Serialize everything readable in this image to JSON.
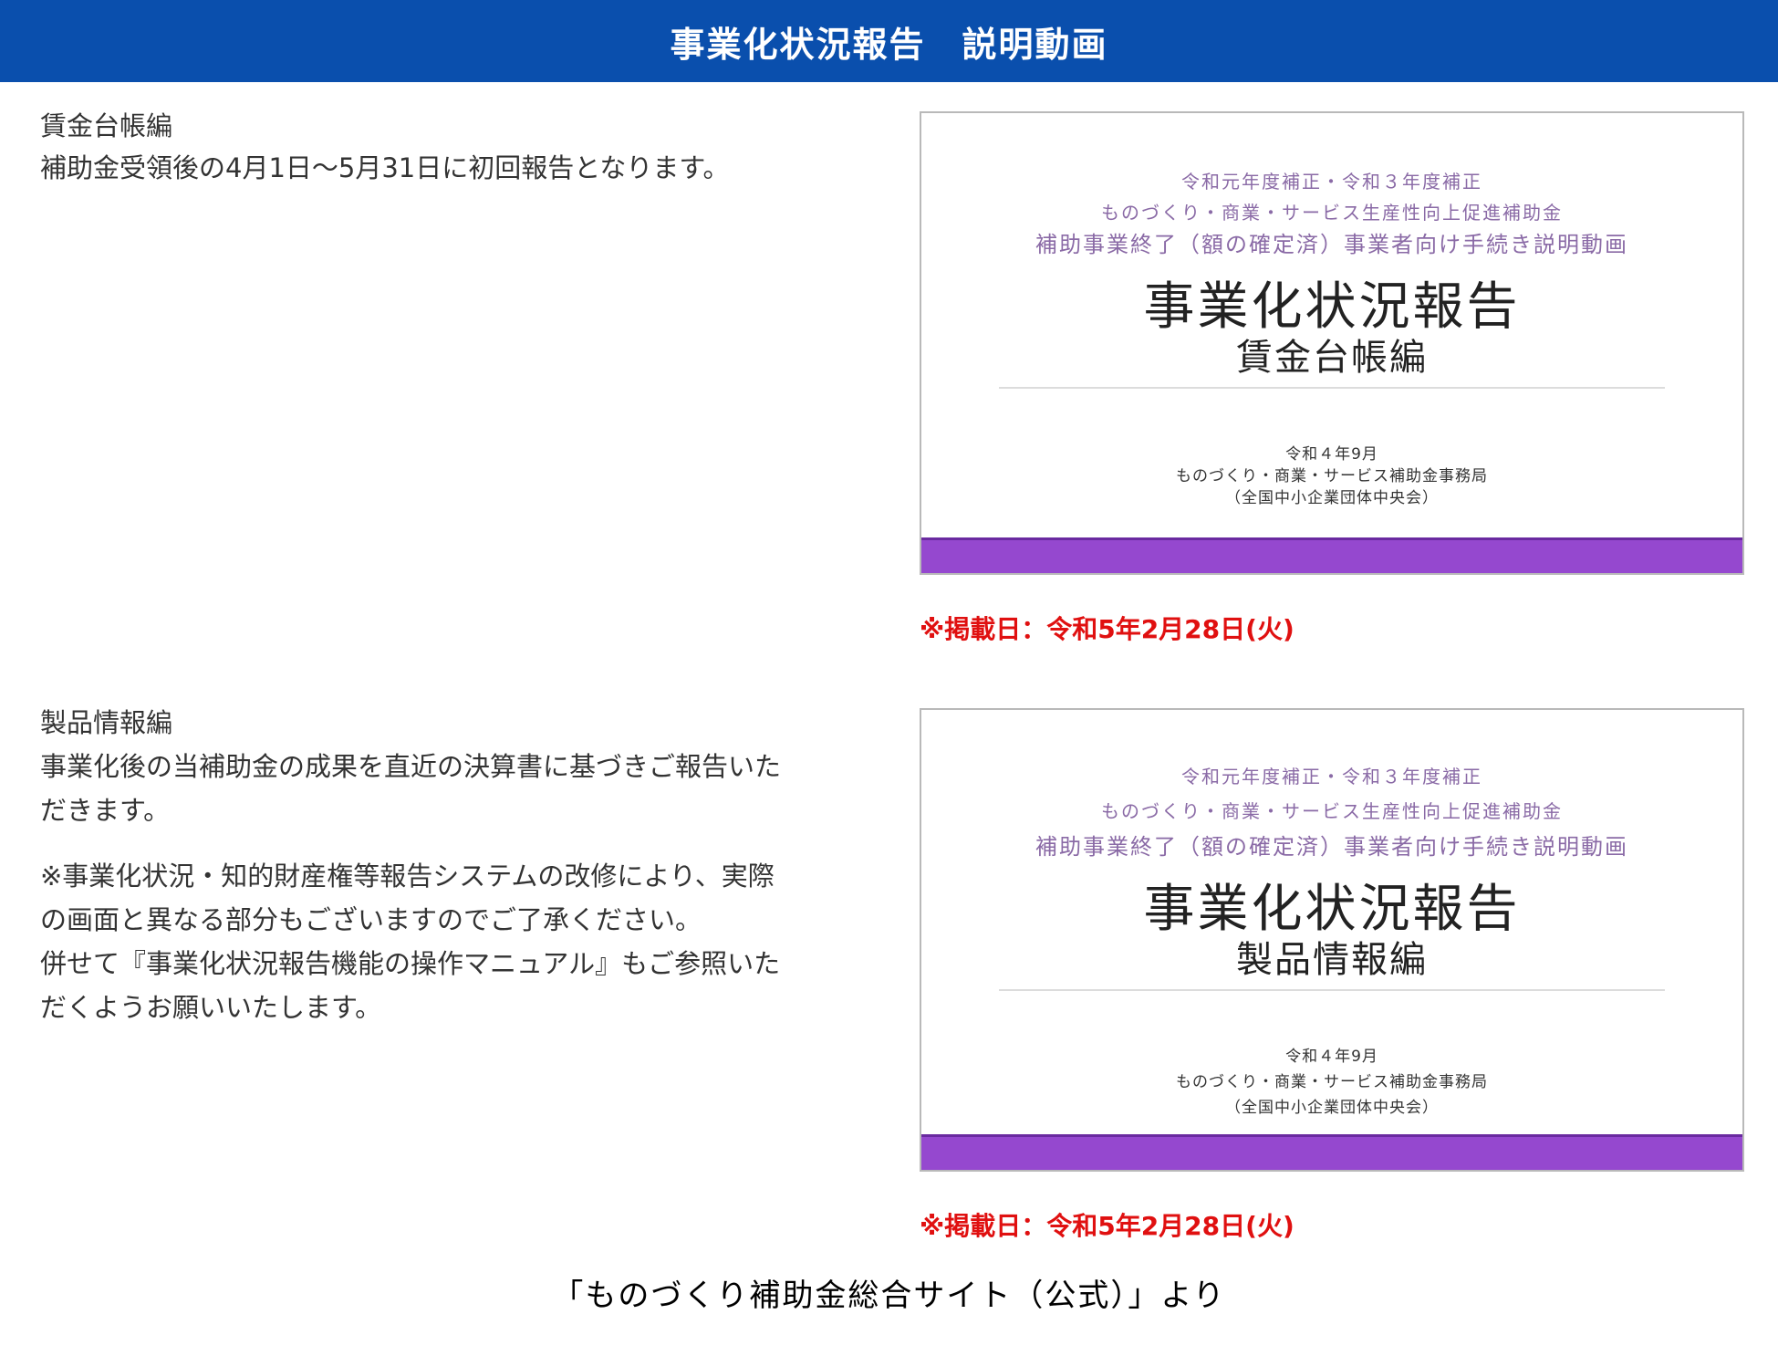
{
  "header": {
    "title": "事業化状況報告　説明動画"
  },
  "sections": [
    {
      "heading": "賃金台帳編",
      "description": "補助金受領後の4月1日～5月31日に初回報告となります。",
      "note_lines": [],
      "thumbnail": {
        "line1": "令和元年度補正・令和３年度補正",
        "line2": "ものづくり・商業・サービス生産性向上促進補助金",
        "line3": "補助事業終了（額の確定済）事業者向け手続き説明動画",
        "main_title": "事業化状況報告",
        "sub_title": "賃金台帳編",
        "date": "令和４年9月",
        "office": "ものづくり・商業・サービス補助金事務局",
        "org": "（全国中小企業団体中央会）"
      },
      "posted_date": "※掲載日：令和5年2月28日(火)"
    },
    {
      "heading": "製品情報編",
      "description_lines": [
        "事業化後の当補助金の成果を直近の決算書に基づきご報告いた",
        "だきます。"
      ],
      "note_lines": [
        "※事業化状況・知的財産権等報告システムの改修により、実際",
        "の画面と異なる部分もございますのでご了承ください。",
        "併せて『事業化状況報告機能の操作マニュアル』もご参照いた",
        "だくようお願いいたします。"
      ],
      "thumbnail": {
        "line1": "令和元年度補正・令和３年度補正",
        "line2": "ものづくり・商業・サービス生産性向上促進補助金",
        "line3": "補助事業終了（額の確定済）事業者向け手続き説明動画",
        "main_title": "事業化状況報告",
        "sub_title": "製品情報編",
        "date": "令和４年9月",
        "office": "ものづくり・商業・サービス補助金事務局",
        "org": "（全国中小企業団体中央会）"
      },
      "posted_date": "※掲載日：令和5年2月28日(火)"
    }
  ],
  "source": "「ものづくり補助金総合サイト（公式）」より",
  "colors": {
    "header_bg": "#0a4fad",
    "posted_date_text": "#e01010",
    "thumbnail_bar": "#9548cf"
  }
}
